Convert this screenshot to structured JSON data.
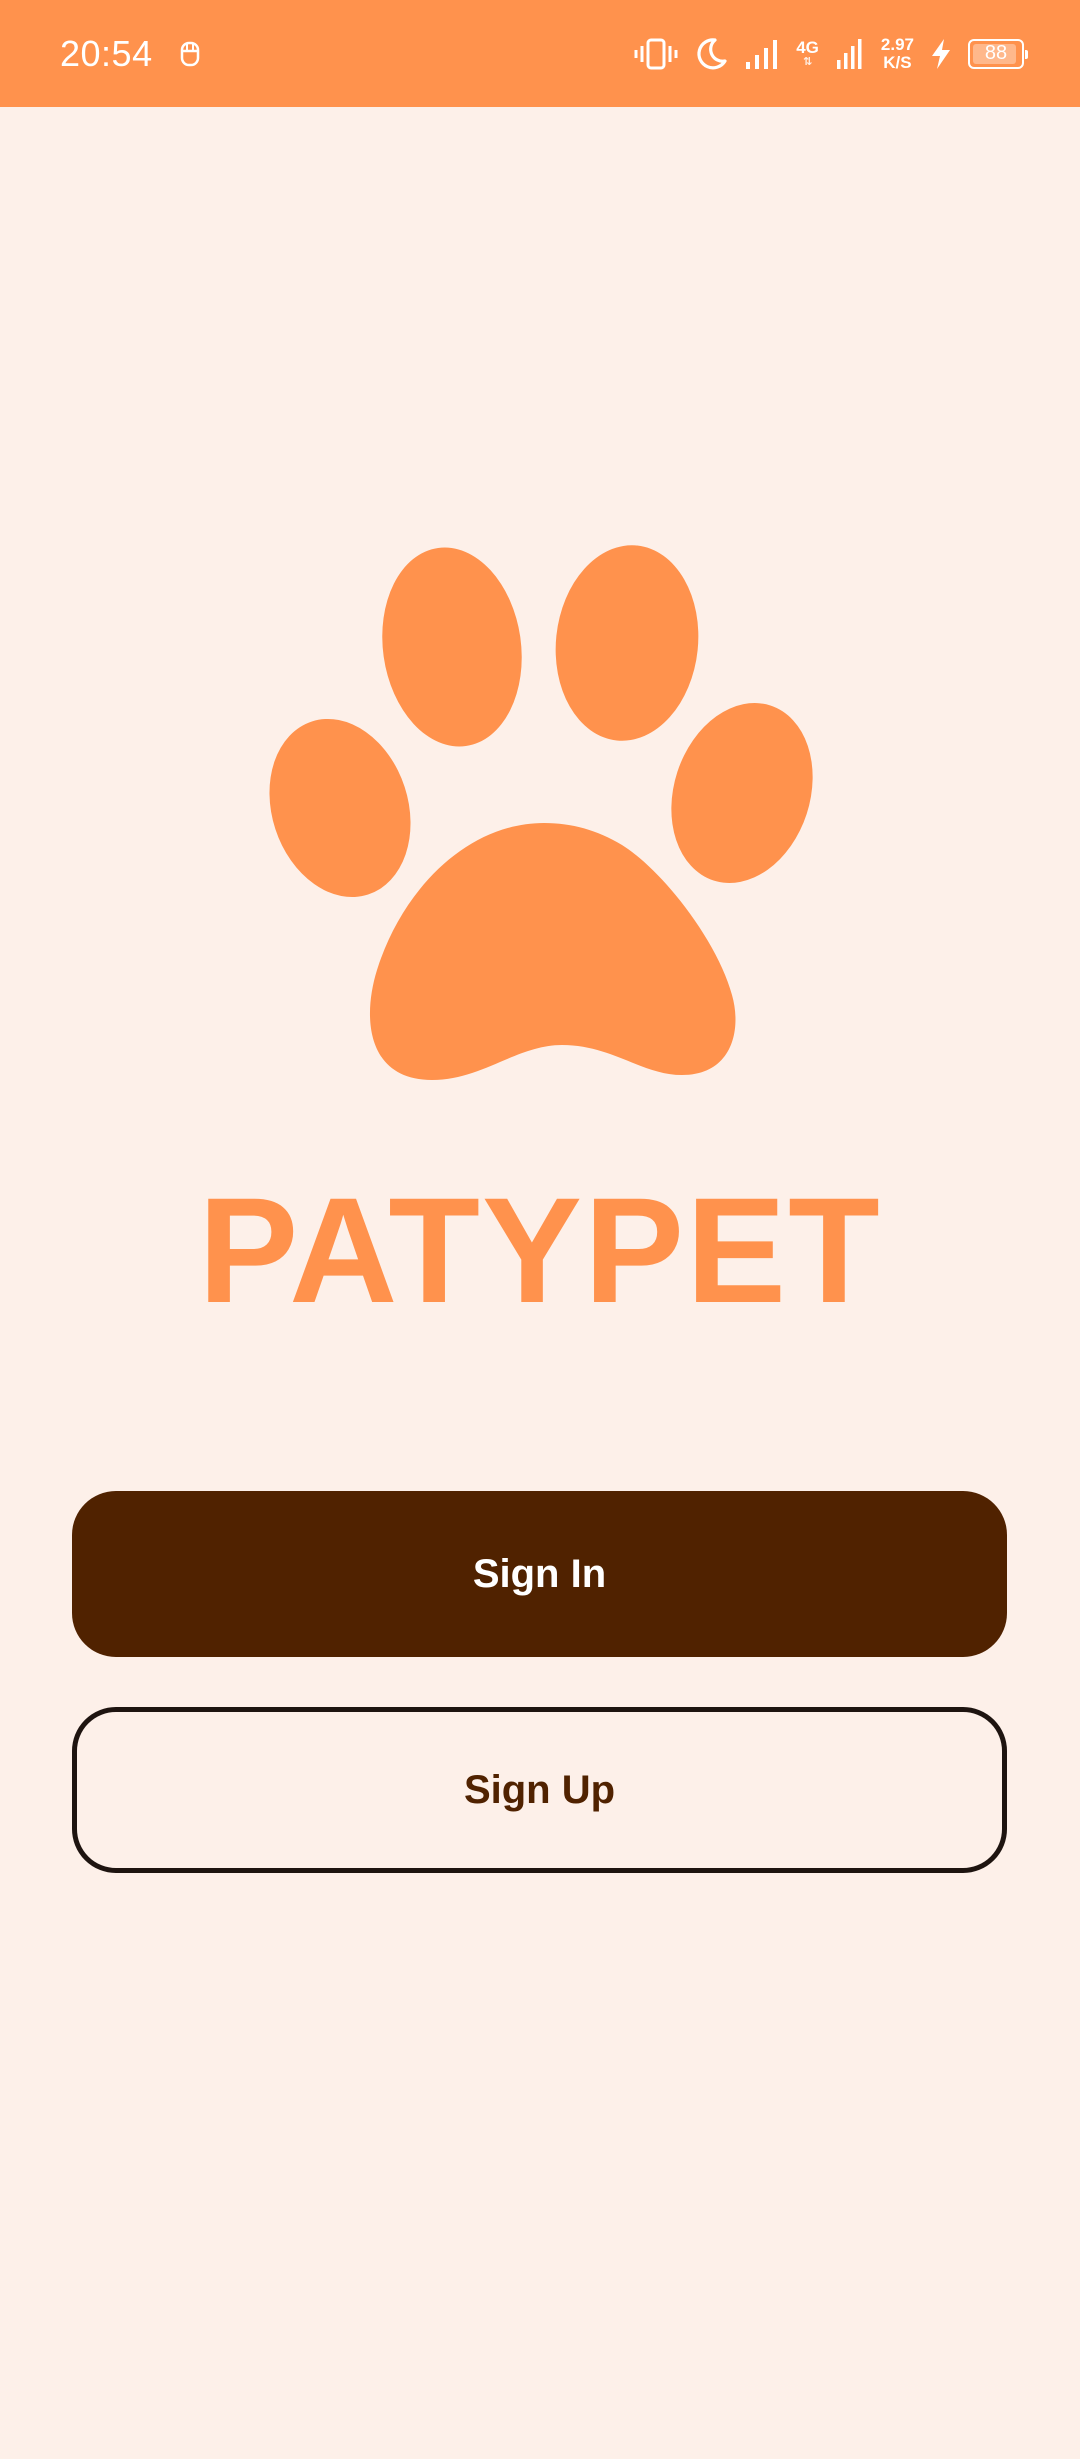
{
  "status_bar": {
    "time": "20:54",
    "network_type": "4G",
    "speed_value": "2.97",
    "speed_unit": "K/S",
    "battery_level": "88",
    "icons": [
      "app-notification-icon",
      "vibrate-icon",
      "do-not-disturb-moon-icon",
      "signal-icon",
      "signal-4g-icon",
      "charging-bolt-icon",
      "battery-icon"
    ]
  },
  "logo": {
    "icon": "paw-icon",
    "color": "#FF924D"
  },
  "app_name": "PATYPET",
  "actions": {
    "sign_in_label": "Sign In",
    "sign_up_label": "Sign Up"
  },
  "colors": {
    "accent": "#FF924D",
    "primary_button": "#502200",
    "background": "#FDF0E9"
  }
}
